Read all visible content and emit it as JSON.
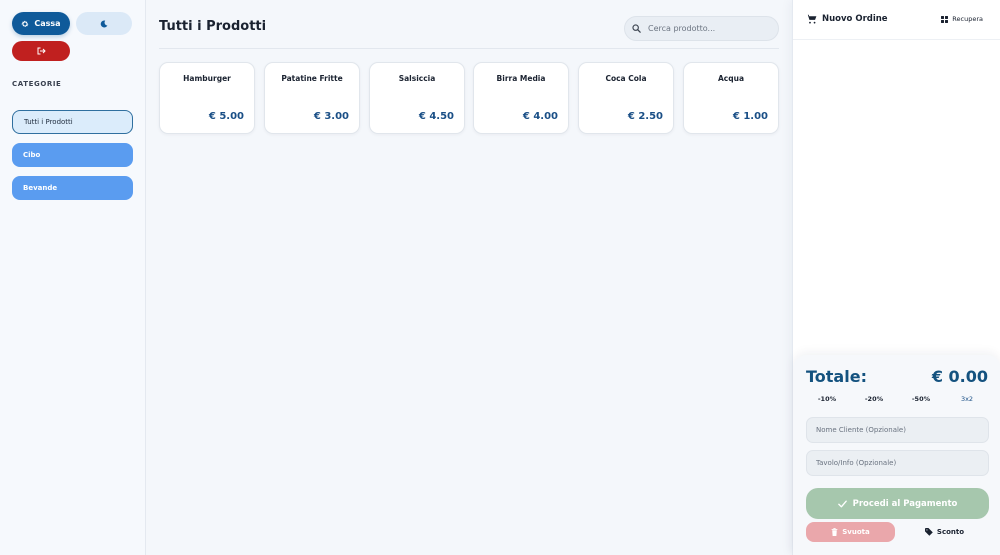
{
  "sidebar": {
    "cassa_label": "Cassa",
    "categories_title": "CATEGORIE",
    "categories": [
      {
        "label": "Tutti i Prodotti",
        "active": true
      },
      {
        "label": "Cibo",
        "active": false
      },
      {
        "label": "Bevande",
        "active": false
      }
    ]
  },
  "main": {
    "title": "Tutti i Prodotti",
    "search_placeholder": "Cerca prodotto...",
    "products": [
      {
        "name": "Hamburger",
        "price": "€ 5.00"
      },
      {
        "name": "Patatine Fritte",
        "price": "€ 3.00"
      },
      {
        "name": "Salsiccia",
        "price": "€ 4.50"
      },
      {
        "name": "Birra Media",
        "price": "€ 4.00"
      },
      {
        "name": "Coca Cola",
        "price": "€ 2.50"
      },
      {
        "name": "Acqua",
        "price": "€ 1.00"
      }
    ]
  },
  "order": {
    "title": "Nuovo Ordine",
    "recover_label": "Recupera",
    "total_label": "Totale:",
    "total_value": "€ 0.00",
    "discounts": [
      "-10%",
      "-20%",
      "-50%",
      "3x2"
    ],
    "customer_placeholder": "Nome Cliente (Opzionale)",
    "table_placeholder": "Tavolo/Info (Opzionale)",
    "pay_label": "Procedi al Pagamento",
    "clear_label": "Svuota",
    "discount_label": "Sconto"
  },
  "colors": {
    "primary": "#0f5a9a",
    "danger": "#c0201f",
    "category": "#5a9cf0",
    "pay_disabled": "#a6c7ad",
    "clear_disabled": "#eaa7ab"
  },
  "icons": {
    "cassa": "gear-icon",
    "theme": "moon-icon",
    "logout": "logout-icon",
    "search": "search-icon",
    "order": "cart-icon",
    "recover": "grid-icon",
    "pay": "check-icon",
    "clear": "trash-icon",
    "discount": "tag-icon"
  }
}
